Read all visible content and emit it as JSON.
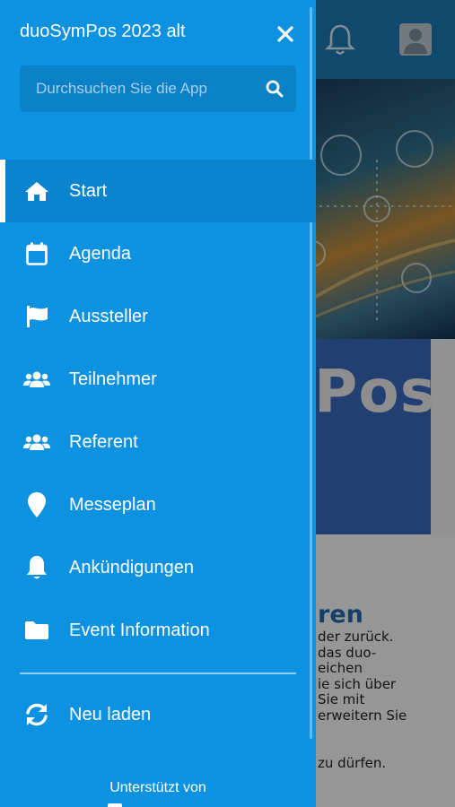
{
  "background": {
    "logo_fragment": "Pos",
    "heading_fragment": "ren",
    "body_lines": "der zurück.\ndas duo-\neichen\nie sich über\nSie mit\nerweitern Sie",
    "body_line2": "zu dürfen."
  },
  "drawer": {
    "title": "duoSymPos 2023 alt",
    "search_placeholder": "Durchsuchen Sie die App",
    "items": [
      {
        "label": "Start",
        "icon": "home-icon",
        "active": true
      },
      {
        "label": "Agenda",
        "icon": "calendar-icon"
      },
      {
        "label": "Aussteller",
        "icon": "flag-icon"
      },
      {
        "label": "Teilnehmer",
        "icon": "users-icon"
      },
      {
        "label": "Referent",
        "icon": "users-icon"
      },
      {
        "label": "Messeplan",
        "icon": "map-pin-icon"
      },
      {
        "label": "Ankündigungen",
        "icon": "bell-icon"
      },
      {
        "label": "Event Information",
        "icon": "folder-icon"
      }
    ],
    "reload_label": "Neu laden",
    "footer_label": "Unterstützt von"
  },
  "colors": {
    "drawer_bg": "#0c92e0",
    "active_item_bg": "#0a84cf",
    "topbar": "#1a77ad"
  }
}
